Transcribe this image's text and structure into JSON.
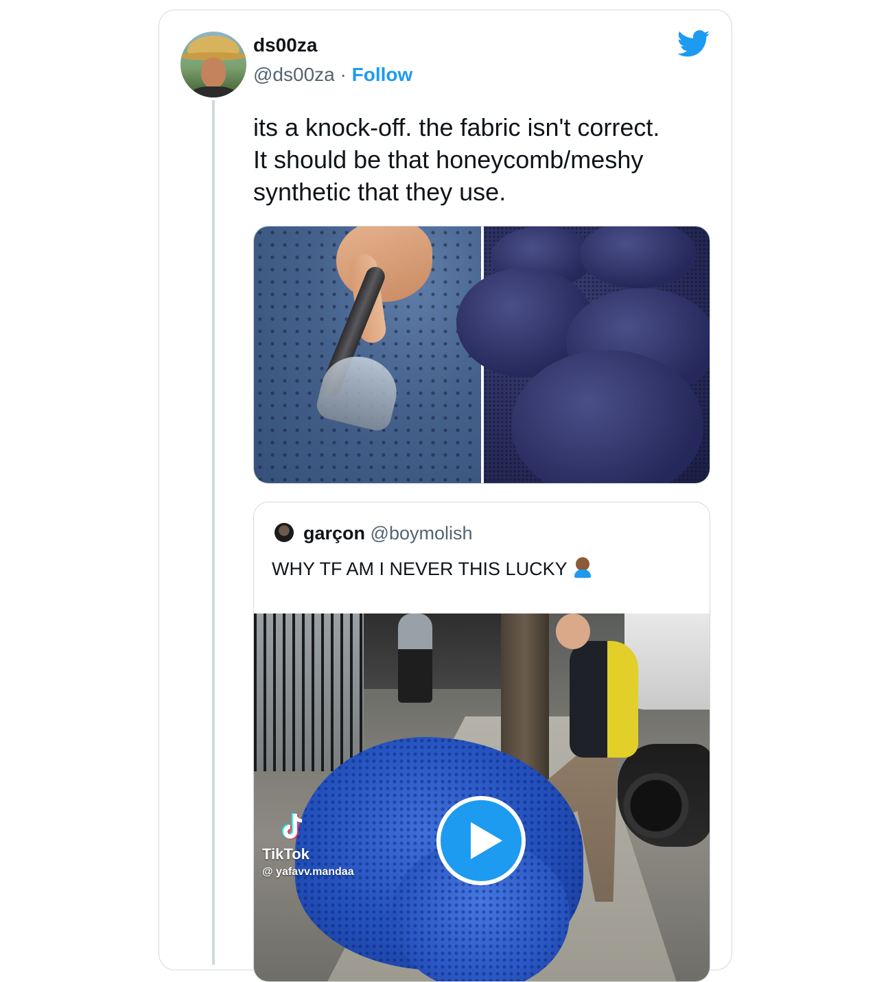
{
  "tweet": {
    "display_name": "ds00za",
    "handle": "@ds00za",
    "separator": "·",
    "follow_label": "Follow",
    "text": "its a knock-off. the fabric isn't correct.\nIt should be that honeycomb/meshy\nsynthetic that they use."
  },
  "quoted": {
    "display_name": "garçon",
    "handle": "@boymolish",
    "text": "WHY TF AM I NEVER THIS LUCKY",
    "video": {
      "watermark_brand": "TikTok",
      "watermark_user": "@ yafavv.mandaa"
    }
  },
  "colors": {
    "accent": "#1d9bf0",
    "text_primary": "#0f1419",
    "text_secondary": "#536471",
    "border": "#cfd9de"
  },
  "icons": {
    "brand": "twitter-bird-icon",
    "play": "play-icon",
    "tiktok": "tiktok-logo-icon",
    "emoji": "person-facepalming-emoji"
  }
}
